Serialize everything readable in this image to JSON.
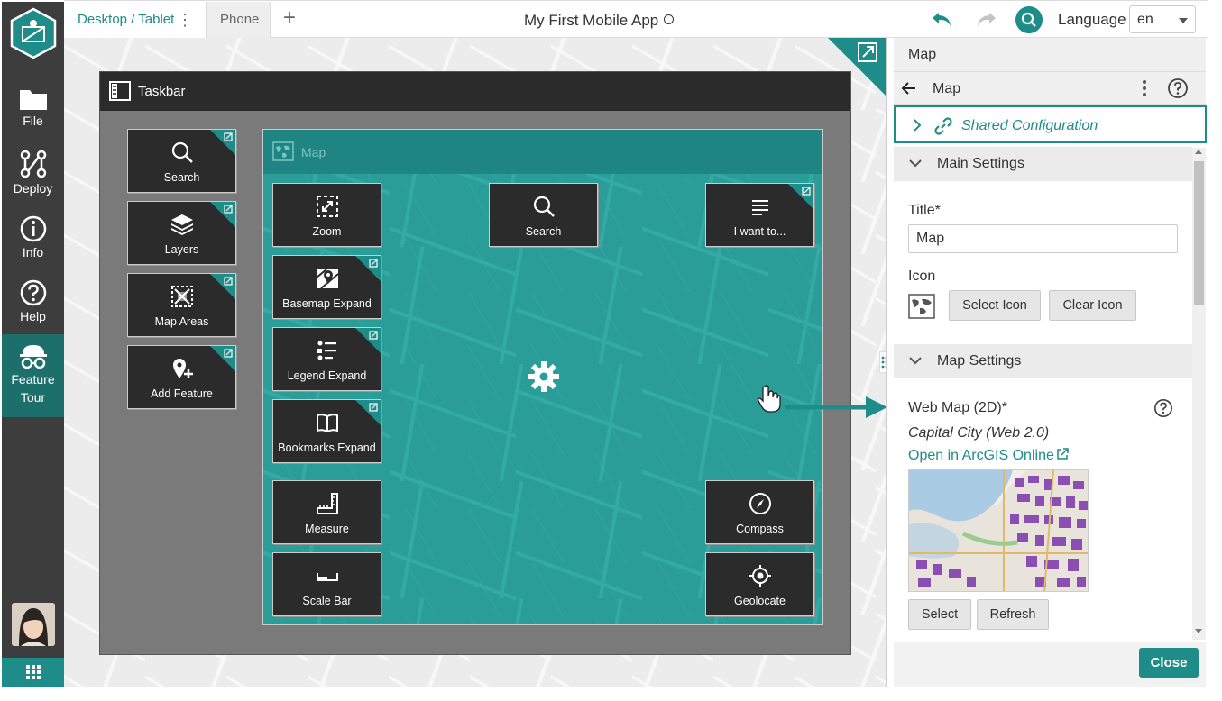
{
  "rail": {
    "items": [
      {
        "label": "File",
        "icon": "folder-icon"
      },
      {
        "label": "Deploy",
        "icon": "deploy-icon"
      },
      {
        "label": "Info",
        "icon": "info-icon"
      },
      {
        "label": "Help",
        "icon": "help-icon"
      },
      {
        "label_line1": "Feature",
        "label_line2": "Tour",
        "icon": "feature-tour-icon"
      }
    ]
  },
  "topbar": {
    "tabs": [
      {
        "label": "Desktop / Tablet"
      },
      {
        "label": "Phone"
      }
    ],
    "add_tab": "+",
    "app_title": "My First Mobile App",
    "language_label": "Language",
    "language_value": "en"
  },
  "canvas": {
    "taskbar_title": "Taskbar",
    "taskbar_tiles": [
      {
        "label": "Search"
      },
      {
        "label": "Layers"
      },
      {
        "label": "Map Areas"
      },
      {
        "label": "Add Feature"
      }
    ],
    "map_title": "Map",
    "map_tiles": [
      {
        "label": "Zoom"
      },
      {
        "label": "Basemap Expand"
      },
      {
        "label": "Legend Expand"
      },
      {
        "label": "Bookmarks Expand"
      },
      {
        "label": "Measure"
      },
      {
        "label": "Scale Bar"
      },
      {
        "label": "Search"
      },
      {
        "label": "I want to..."
      },
      {
        "label": "Compass"
      },
      {
        "label": "Geolocate"
      }
    ]
  },
  "panel": {
    "header": "Map",
    "nav_title": "Map",
    "shared_config": "Shared Configuration",
    "main_settings": "Main Settings",
    "title_label": "Title*",
    "title_value": "Map",
    "icon_label": "Icon",
    "select_icon": "Select Icon",
    "clear_icon": "Clear Icon",
    "map_settings": "Map Settings",
    "webmap_label": "Web Map (2D)*",
    "webmap_name": "Capital City (Web 2.0)",
    "webmap_link": "Open in ArcGIS Online",
    "select": "Select",
    "refresh": "Refresh",
    "close": "Close"
  },
  "colors": {
    "accent": "#1e8c88",
    "rail_bg": "#3d3d3d",
    "map_bg": "#2a9d99",
    "tile_bg": "#2b2b2b"
  }
}
